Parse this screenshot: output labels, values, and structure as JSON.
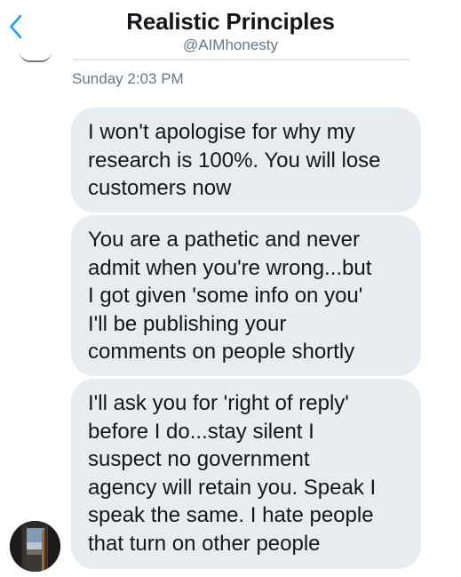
{
  "header": {
    "title": "Realistic Principles",
    "handle": "@AIMhonesty"
  },
  "conversation": {
    "timestamp": "Sunday 2:03 PM",
    "messages": [
      {
        "text": "I won't apologise for why my\nresearch is 100%. You will lose\ncustomers now"
      },
      {
        "text": "You are a pathetic and never\nadmit when you're wrong...but\nI got given 'some info on you'\nI'll be publishing your\ncomments on people shortly"
      },
      {
        "text": "I'll ask you for 'right of reply'\nbefore I do...stay silent I\nsuspect no government\nagency will retain you. Speak I\nspeak the same. I hate people\nthat turn on other people"
      }
    ]
  },
  "colors": {
    "accent": "#1da1f2",
    "bubble": "#e6ecf0",
    "text": "#14171a",
    "muted": "#657786"
  },
  "icons": {
    "back": "chevron-left-icon",
    "avatar": "avatar"
  }
}
